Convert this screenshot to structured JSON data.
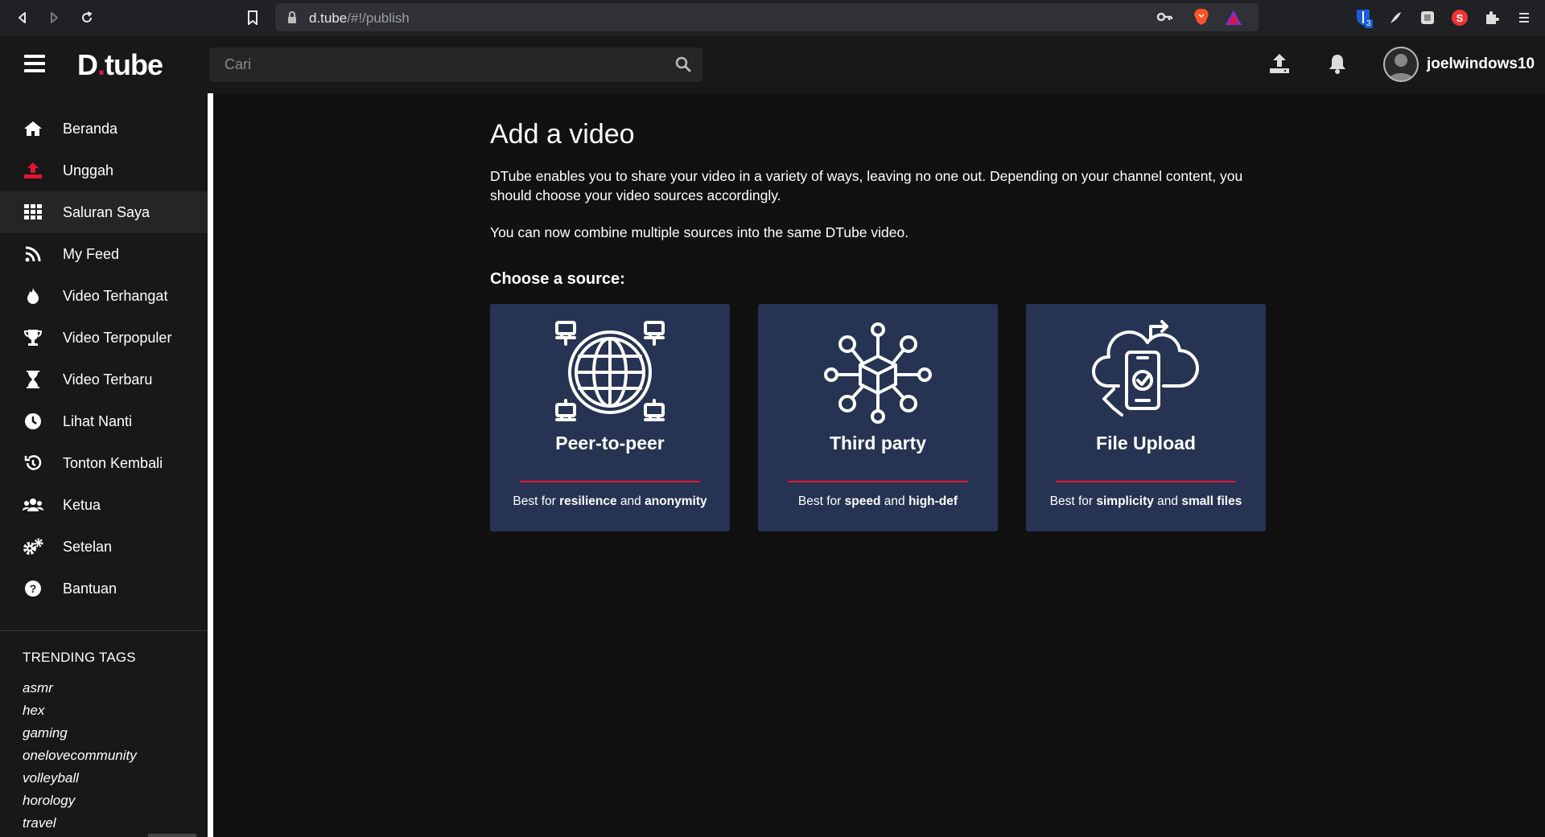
{
  "browser": {
    "url_host": "d.tube",
    "url_path": "/#!/publish",
    "bitwarden_badge": "3"
  },
  "header": {
    "logo_d": "D",
    "logo_rest": "tube",
    "search_placeholder": "Cari",
    "username": "joelwindows10"
  },
  "sidebar": {
    "items": [
      {
        "label": "Beranda",
        "icon": "home-icon"
      },
      {
        "label": "Unggah",
        "icon": "upload-icon"
      },
      {
        "label": "Saluran Saya",
        "icon": "grid-icon"
      },
      {
        "label": "My Feed",
        "icon": "rss-icon"
      },
      {
        "label": "Video Terhangat",
        "icon": "fire-icon"
      },
      {
        "label": "Video Terpopuler",
        "icon": "trophy-icon"
      },
      {
        "label": "Video Terbaru",
        "icon": "hourglass-icon"
      },
      {
        "label": "Lihat Nanti",
        "icon": "clock-icon"
      },
      {
        "label": "Tonton Kembali",
        "icon": "history-icon"
      },
      {
        "label": "Ketua",
        "icon": "users-icon"
      },
      {
        "label": "Setelan",
        "icon": "gears-icon"
      },
      {
        "label": "Bantuan",
        "icon": "question-icon"
      }
    ],
    "trending_title": "TRENDING TAGS",
    "tags": [
      "asmr",
      "hex",
      "gaming",
      "onelovecommunity",
      "volleyball",
      "horology",
      "travel"
    ]
  },
  "main": {
    "title": "Add a video",
    "intro1": "DTube enables you to share your video in a variety of ways, leaving no one out. Depending on your channel content, you should choose your video sources accordingly.",
    "intro2": "You can now combine multiple sources into the same DTube video.",
    "choose": "Choose a source:",
    "cards": [
      {
        "title": "Peer-to-peer",
        "desc_pre": "Best for ",
        "desc_b1": "resilience",
        "desc_mid": " and ",
        "desc_b2": "anonymity",
        "icon": "globe-network-icon"
      },
      {
        "title": "Third party",
        "desc_pre": "Best for ",
        "desc_b1": "speed",
        "desc_mid": " and ",
        "desc_b2": "high-def",
        "icon": "cube-network-icon"
      },
      {
        "title": "File Upload",
        "desc_pre": "Best for ",
        "desc_b1": "simplicity",
        "desc_mid": " and ",
        "desc_b2": "small files",
        "icon": "cloud-phone-icon"
      }
    ]
  },
  "colors": {
    "accent": "#e31337",
    "card_bg": "#263352",
    "sidebar_bg": "#181818",
    "page_bg": "#111111"
  }
}
